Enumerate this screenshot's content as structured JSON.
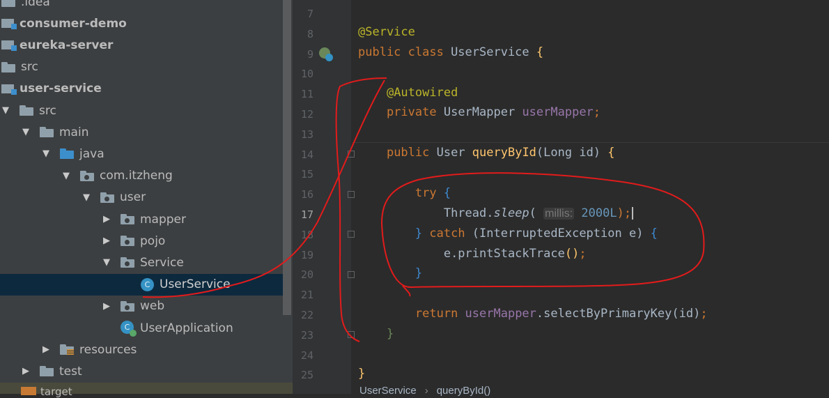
{
  "project_tree": {
    "items": [
      {
        "label": ".idea",
        "indent": 0,
        "icon": "folder",
        "arrow": "none",
        "bold": false
      },
      {
        "label": "consumer-demo",
        "indent": 0,
        "icon": "module",
        "arrow": "none",
        "bold": true
      },
      {
        "label": "eureka-server",
        "indent": 0,
        "icon": "module",
        "arrow": "none",
        "bold": true
      },
      {
        "label": "src",
        "indent": 0,
        "icon": "folder",
        "arrow": "none",
        "bold": false
      },
      {
        "label": "user-service",
        "indent": 0,
        "icon": "module",
        "arrow": "none",
        "bold": true
      },
      {
        "label": "src",
        "indent": 0,
        "icon": "folder",
        "arrow": "down",
        "bold": false
      },
      {
        "label": "main",
        "indent": 1,
        "icon": "folder",
        "arrow": "down",
        "bold": false
      },
      {
        "label": "java",
        "indent": 2,
        "icon": "folder-blue",
        "arrow": "down",
        "bold": false
      },
      {
        "label": "com.itzheng",
        "indent": 3,
        "icon": "package",
        "arrow": "down",
        "bold": false
      },
      {
        "label": "user",
        "indent": 4,
        "icon": "package",
        "arrow": "down",
        "bold": false
      },
      {
        "label": "mapper",
        "indent": 5,
        "icon": "package",
        "arrow": "right",
        "bold": false
      },
      {
        "label": "pojo",
        "indent": 5,
        "icon": "package",
        "arrow": "right",
        "bold": false
      },
      {
        "label": "Service",
        "indent": 5,
        "icon": "package",
        "arrow": "down",
        "bold": false
      },
      {
        "label": "UserService",
        "indent": 6,
        "icon": "class",
        "arrow": "none",
        "bold": false,
        "selected": true
      },
      {
        "label": "web",
        "indent": 5,
        "icon": "package",
        "arrow": "right",
        "bold": false
      },
      {
        "label": "UserApplication",
        "indent": 5,
        "icon": "app-class",
        "arrow": "none",
        "bold": false
      },
      {
        "label": "resources",
        "indent": 2,
        "icon": "resources-folder",
        "arrow": "right",
        "bold": false
      },
      {
        "label": "test",
        "indent": 1,
        "icon": "folder",
        "arrow": "right",
        "bold": false
      },
      {
        "label": "target",
        "indent": 0,
        "icon": "folder-orange",
        "arrow": "none",
        "bold": false
      }
    ]
  },
  "editor": {
    "line_numbers": [
      "7",
      "8",
      "9",
      "10",
      "11",
      "12",
      "13",
      "14",
      "15",
      "16",
      "17",
      "18",
      "19",
      "20",
      "21",
      "22",
      "23",
      "24",
      "25"
    ],
    "current_line": "17",
    "code": {
      "l8_annotation": "@Service",
      "l9_kw": "public class ",
      "l9_name": "UserService ",
      "l9_brace": "{",
      "l11_annotation": "@Autowired",
      "l12_kw": "private ",
      "l12_type": "UserMapper ",
      "l12_field": "userMapper",
      "l12_semi": ";",
      "l14_kw": "public ",
      "l14_type": "User ",
      "l14_method": "queryById",
      "l14_params": "(Long id) ",
      "l14_brace": "{",
      "l16_kw": "try ",
      "l16_brace": "{",
      "l17_class": "Thread.",
      "l17_method": "sleep",
      "l17_open": "( ",
      "l17_hint": "millis:",
      "l17_num": " 2000L",
      "l17_close": ");",
      "l18_close": "} ",
      "l18_kw": "catch ",
      "l18_params": "(InterruptedException e) ",
      "l18_brace": "{",
      "l19_call": "e.printStackTrace",
      "l19_paren": "()",
      "l19_semi": ";",
      "l20_brace": "}",
      "l22_kw": "return ",
      "l22_field": "userMapper",
      "l22_call": ".selectByPrimaryKey(id)",
      "l22_semi": ";",
      "l23_brace": "}",
      "l25_brace": "}"
    },
    "breadcrumb": [
      "UserService",
      "queryById()"
    ],
    "breadcrumb_sep": "›"
  },
  "colors": {
    "keyword": "#cc7832",
    "annotation": "#bbb529",
    "method": "#ffc66d",
    "field": "#9876aa",
    "number": "#6897bb",
    "annotation_ink": "#e31b1b"
  },
  "icons": [
    "folder-icon",
    "module-icon",
    "class-icon",
    "spring-bean-icon",
    "fold-marker-icon",
    "expand-arrow-icon"
  ]
}
